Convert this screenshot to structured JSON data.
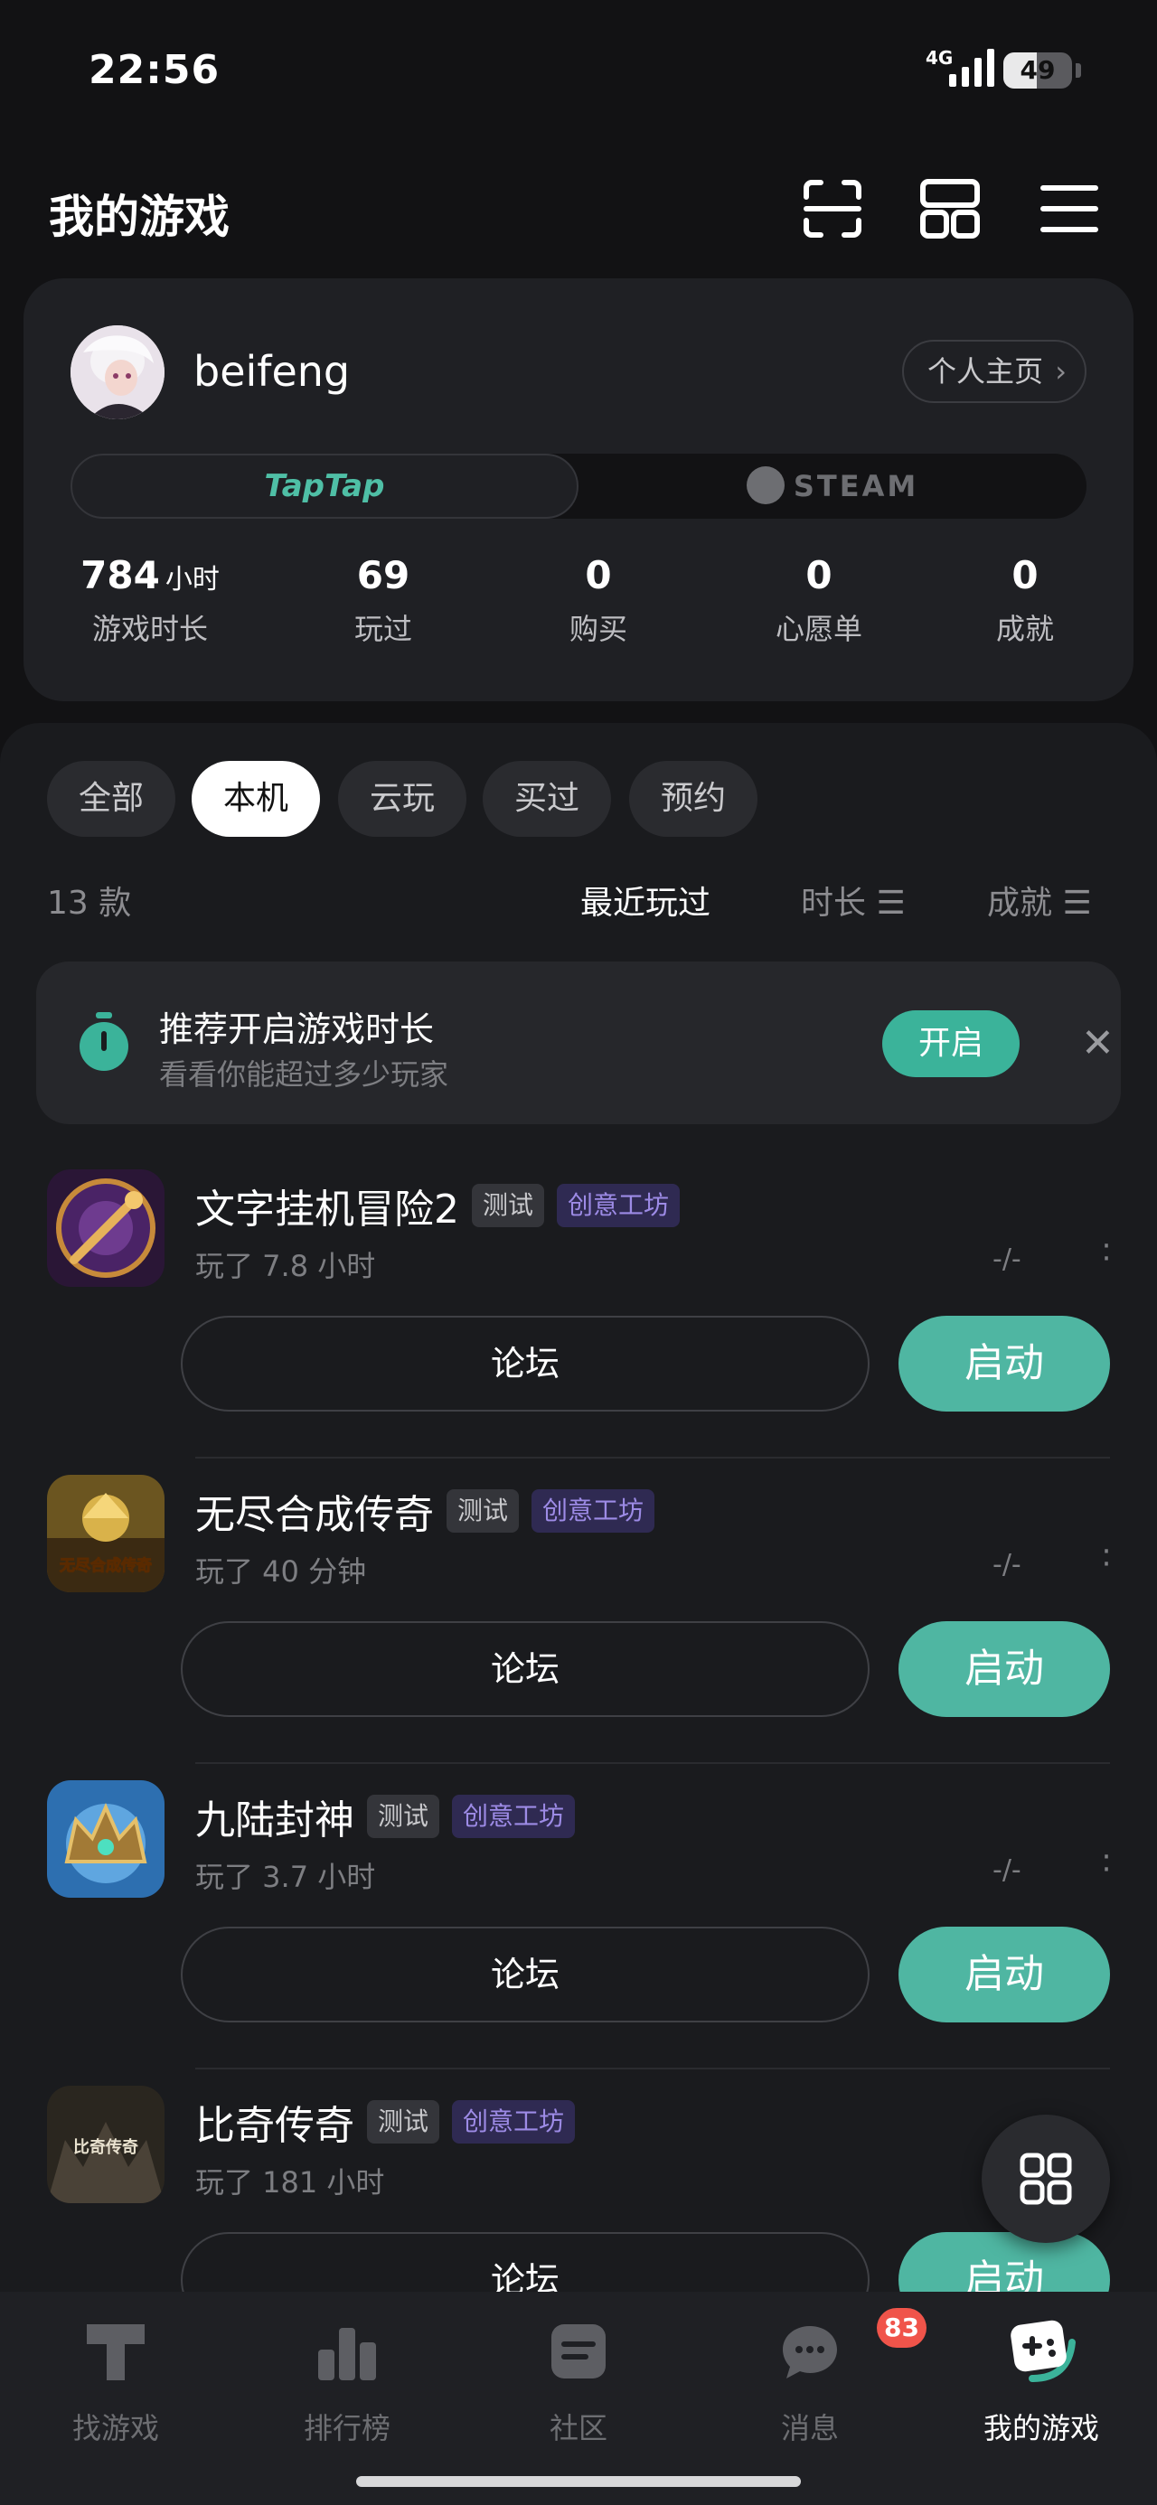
{
  "status": {
    "time": "22:56",
    "network": "4G",
    "battery": "49",
    "battery_level": 0.49
  },
  "header": {
    "title": "我的游戏",
    "icons": [
      "scan-icon",
      "grid-view-icon",
      "menu-icon"
    ]
  },
  "profile": {
    "username": "beifeng",
    "homepage_label": "个人主页",
    "platforms": {
      "taptap": "TapTap",
      "steam": "STEAM"
    },
    "stats": [
      {
        "value": "784",
        "unit": "小时",
        "label": "游戏时长"
      },
      {
        "value": "69",
        "unit": "",
        "label": "玩过"
      },
      {
        "value": "0",
        "unit": "",
        "label": "购买"
      },
      {
        "value": "0",
        "unit": "",
        "label": "心愿单"
      },
      {
        "value": "0",
        "unit": "",
        "label": "成就"
      }
    ]
  },
  "filters": [
    "全部",
    "本机",
    "云玩",
    "买过",
    "预约"
  ],
  "active_filter": "本机",
  "count": "13 款",
  "sort": {
    "recent": "最近玩过",
    "duration": "时长",
    "achievement": "成就"
  },
  "banner": {
    "title": "推荐开启游戏时长",
    "subtitle": "看看你能超过多少玩家",
    "button": "开启"
  },
  "games": [
    {
      "name": "文字挂机冒险2",
      "tag_test": "测试",
      "tag_workshop": "创意工坊",
      "played": "玩了 7.8 小时",
      "achievement": "-/-",
      "forum": "论坛",
      "launch": "启动"
    },
    {
      "name": "无尽合成传奇",
      "tag_test": "测试",
      "tag_workshop": "创意工坊",
      "played": "玩了 40 分钟",
      "achievement": "-/-",
      "forum": "论坛",
      "launch": "启动",
      "icon_text": "无尽合成传奇"
    },
    {
      "name": "九陆封神",
      "tag_test": "测试",
      "tag_workshop": "创意工坊",
      "played": "玩了 3.7 小时",
      "achievement": "-/-",
      "forum": "论坛",
      "launch": "启动"
    },
    {
      "name": "比奇传奇",
      "tag_test": "测试",
      "tag_workshop": "创意工坊",
      "played": "玩了 181 小时",
      "achievement": "",
      "forum": "论坛",
      "launch": "启动",
      "icon_text": "比奇传奇"
    }
  ],
  "nav": [
    {
      "label": "找游戏",
      "icon": "find-games-icon"
    },
    {
      "label": "排行榜",
      "icon": "ranking-icon"
    },
    {
      "label": "社区",
      "icon": "community-icon"
    },
    {
      "label": "消息",
      "icon": "message-icon",
      "badge": "83"
    },
    {
      "label": "我的游戏",
      "icon": "my-games-icon"
    }
  ],
  "colors": {
    "accent": "#4fb6a2",
    "badge": "#f0544a",
    "workshop": "#9d8be6"
  }
}
